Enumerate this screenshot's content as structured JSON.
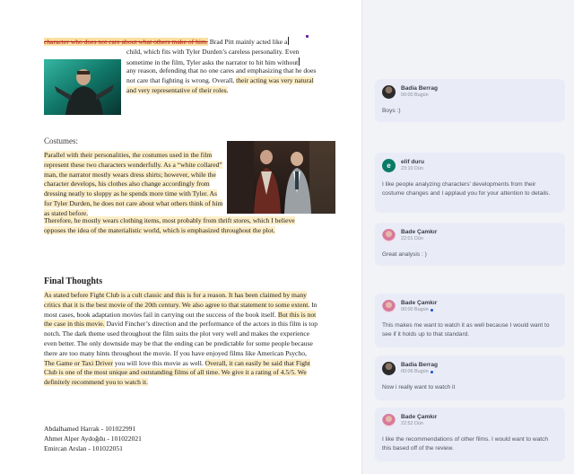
{
  "document": {
    "p1_struck": "character who does not care about what others make of him.",
    "p1_first": " Brad Pitt mainly acted like a",
    "p1_wrap": "child, which fits with Tyler Durden’s careless personality. Even sometime in the film, Tyler asks the narrator to hit him without",
    "p1_rest_plain": " any reason, defending that no one cares and emphasizing that he does not care that fighting is wrong. Overall, ",
    "p1_rest_hl": "their acting was very natural and very representative of their roles.",
    "costumes_heading": "Costumes:",
    "p2_hl": "Parallel with their personalities, the costumes used in the film represent these two characters wonderfully. As a “white collared” man, the narrator mostly wears dress shirts; however, while the character develops, his clothes also change accordingly from dressing neatly to sloppy as he spends more time with Tyler. As for Tyler Durden, he does not care about what others think of him as stated before.",
    "p2b_hl": "Therefore, he mostly wears clothing items, most probably from thrift stores, which I believe opposes the idea of the materialistic world, which is emphasized throughout the plot.",
    "final_heading": "Final Thoughts",
    "p3_hl1": "As stated before Fight Club is a cult classic and this is for a reason. It has been claimed by many critics that it is the best movie of the 20th century. We also agree to that statement to some extent.",
    "p3_plain1": " In most cases, book adaptation movies fail in carrying out the success of the book itself. ",
    "p3_hl2": "But this is not the case in this movie.",
    "p3_plain2": " David Fincher’s direction and the performance of the actors in this film is top notch. The dark theme used throughout the film suits the plot very well and makes the experience even better. The only downside may be that the ending can be predictable for some people because there are too many hints throughout the movie. If you have enjoyed films like American Psycho, ",
    "p3_hl3": "The Game or Taxi Driver",
    "p3_plain3": " you will love this movie as well. ",
    "p3_hl4": "Overall, it can easily be said that Fight Club is one of the most unique and outstanding films of all time. We give it a rating of 4.5/5. We definitely recommend you to watch it.",
    "authors": [
      "Abdalhamed Harrak - 101022991",
      "Ahmet Alper Aydoğdu - 101022021",
      "Emircan Arslan - 101022051"
    ]
  },
  "comments": [
    {
      "author": "Badia Berrag",
      "time": "00:00 Bugün",
      "unread": false,
      "avatar": "photo-dark",
      "text": "Boys :)"
    },
    {
      "author": "elif duru",
      "time": "23:10 Dün",
      "unread": false,
      "avatar_letter": "e",
      "text": "I like people analyzing characters' developments from their costume changes and I applaud you for your attention to details."
    },
    {
      "author": "Bade Çamkır",
      "time": "22:01 Dün",
      "unread": false,
      "avatar": "photo-pink",
      "text": "Great analysis : )"
    },
    {
      "author": "Bade Çamkır",
      "time": "00:00 Bugün",
      "unread": true,
      "avatar": "photo-pink",
      "text": "This makes me want to watch it as well because I would want to see if it holds up to that standard."
    },
    {
      "author": "Badia Berrag",
      "time": "00:06 Bugün",
      "unread": true,
      "avatar": "photo-dark",
      "text": "Now i really want to watch it"
    },
    {
      "author": "Bade Çamkır",
      "time": "22:52 Dün",
      "unread": false,
      "avatar": "photo-pink",
      "text": "I like the recommendations of other films. I would want to watch this based off of the review."
    }
  ],
  "colors": {
    "highlight": "#fdeec7",
    "comment_card": "#e9ecf7",
    "pane_bg": "#f2f3f7",
    "unread_dot": "#1f4fd6",
    "elif_avatar": "#0b7a66"
  }
}
